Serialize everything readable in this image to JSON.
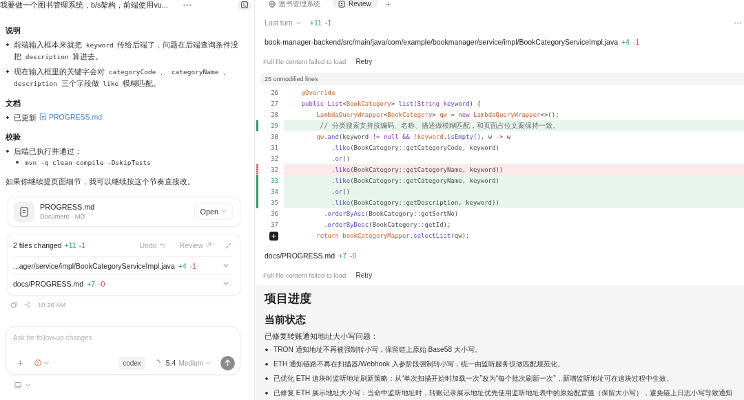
{
  "chat": {
    "thread_title": "我要做一个图书管理系统，b/s架构，前端使用vu...",
    "sections": [
      {
        "heading": "说明",
        "items": [
          {
            "parts": [
              {
                "kind": "text",
                "text": "前端输入框本来就把"
              },
              {
                "kind": "code",
                "text": "keyword"
              },
              {
                "kind": "text",
                "text": "传给后端了，问题在后端查询条件没把"
              },
              {
                "kind": "code",
                "text": "description"
              },
              {
                "kind": "text",
                "text": "算进去。"
              }
            ]
          },
          {
            "parts": [
              {
                "kind": "text",
                "text": "现在输入框里的关键字会对"
              },
              {
                "kind": "code",
                "text": "categoryCode"
              },
              {
                "kind": "text",
                "text": "、"
              },
              {
                "kind": "code",
                "text": "categoryName"
              },
              {
                "kind": "text",
                "text": "、"
              },
              {
                "kind": "code",
                "text": "description"
              },
              {
                "kind": "text",
                "text": "三个字段做"
              },
              {
                "kind": "code",
                "text": "like"
              },
              {
                "kind": "text",
                "text": "模糊匹配。"
              }
            ]
          }
        ]
      },
      {
        "heading": "文档",
        "items": [
          {
            "parts": [
              {
                "kind": "text",
                "text": "已更新"
              }
            ],
            "link": "PROGRESS.md"
          }
        ]
      },
      {
        "heading": "校验",
        "items": [
          {
            "parts": [
              {
                "kind": "text",
                "text": "后端已执行并通过："
              }
            ],
            "children": [
              {
                "parts": [
                  {
                    "kind": "code",
                    "text": "mvn -q clean compile -DskipTests"
                  }
                ]
              }
            ]
          }
        ]
      }
    ],
    "closing": "如果你继续提页面细节，我可以继续按这个节奏直接改。",
    "file_card": {
      "name": "PROGRESS.md",
      "meta": "Document · MD",
      "action": "Open"
    },
    "changes": {
      "summary": "2 files changed",
      "added": "+11",
      "removed": "-1",
      "undo": "Undo",
      "review": "Review",
      "files": [
        {
          "path": "...ager/service/impl/BookCategoryServiceImpl.java",
          "added": "+4",
          "removed": "-1"
        },
        {
          "path": "docs/PROGRESS.md",
          "added": "+7",
          "removed": "-0"
        }
      ]
    },
    "time": "10:26 AM",
    "composer": {
      "placeholder": "Ask for follow-up changes",
      "agent": "codex",
      "model": "5.4",
      "effort": "Medium"
    }
  },
  "tabs": [
    {
      "label": "图书管理系统",
      "kind": "site",
      "selected": false
    },
    {
      "label": "Review",
      "kind": "review",
      "selected": true
    }
  ],
  "review": {
    "scope": "Last turn",
    "added": "+11",
    "removed": "-1",
    "files": [
      {
        "kind": "code",
        "path": "book-manager-backend/src/main/java/com/example/bookmanager/service/impl/BookCategoryServiceImpl.java",
        "added": "+4",
        "removed": "-1",
        "error": "Full file content failed to load",
        "retry": "Retry",
        "collapsed": "25 unmodified lines",
        "lines": [
          {
            "number": "26",
            "kind": "context",
            "hovered": false,
            "tokens": [
              {
                "kind": "annot",
                "text": "    @Override"
              }
            ]
          },
          {
            "number": "27",
            "kind": "context",
            "hovered": false,
            "tokens": [
              {
                "kind": "kw",
                "text": "    public List"
              },
              {
                "kind": "plain",
                "text": "<"
              },
              {
                "kind": "type",
                "text": "BookCategory"
              },
              {
                "kind": "plain",
                "text": "> "
              },
              {
                "kind": "fn",
                "text": "list"
              },
              {
                "kind": "plain",
                "text": "("
              },
              {
                "kind": "kw",
                "text": "String"
              },
              {
                "kind": "fn",
                "text": " keyword"
              },
              {
                "kind": "plain",
                "text": ") {"
              }
            ]
          },
          {
            "number": "28",
            "kind": "context",
            "hovered": false,
            "tokens": [
              {
                "kind": "type",
                "text": "        LambdaQueryWrapper"
              },
              {
                "kind": "plain",
                "text": "<"
              },
              {
                "kind": "type",
                "text": "BookCategory"
              },
              {
                "kind": "plain",
                "text": "> "
              },
              {
                "kind": "type",
                "text": "qw"
              },
              {
                "kind": "plain",
                "text": " = "
              },
              {
                "kind": "kw",
                "text": "new"
              },
              {
                "kind": "type",
                "text": " LambdaQueryWrapper"
              },
              {
                "kind": "plain",
                "text": "<>();"
              }
            ]
          },
          {
            "number": "29",
            "kind": "added",
            "hovered": false,
            "tokens": [
              {
                "kind": "comment",
                "text": "        // 分类搜索支持按编码、名称、描述做模糊匹配，和页面占位文案保持一致。"
              }
            ]
          },
          {
            "number": "30",
            "kind": "context",
            "hovered": false,
            "tokens": [
              {
                "kind": "type",
                "text": "        qw"
              },
              {
                "kind": "fn",
                "text": ".and"
              },
              {
                "kind": "plain",
                "text": "(keyword "
              },
              {
                "kind": "kw",
                "text": "!="
              },
              {
                "kind": "kw",
                "text": " null"
              },
              {
                "kind": "kw",
                "text": " &&"
              },
              {
                "kind": "kw",
                "text": " !"
              },
              {
                "kind": "type",
                "text": "keyword"
              },
              {
                "kind": "fn",
                "text": ".isEmpty"
              },
              {
                "kind": "plain",
                "text": "(), w "
              },
              {
                "kind": "kw",
                "text": "->"
              },
              {
                "kind": "plain",
                "text": " w"
              }
            ]
          },
          {
            "number": "31",
            "kind": "context",
            "hovered": false,
            "tokens": [
              {
                "kind": "fn",
                "text": "            .like"
              },
              {
                "kind": "plain",
                "text": "(BookCategory::getCategoryCode, keyword)"
              }
            ]
          },
          {
            "number": "32",
            "kind": "context",
            "hovered": false,
            "tokens": [
              {
                "kind": "fn",
                "text": "            .or"
              },
              {
                "kind": "plain",
                "text": "()"
              }
            ]
          },
          {
            "number": "32",
            "kind": "removed",
            "hovered": false,
            "tokens": [
              {
                "kind": "fn",
                "text": "            .like"
              },
              {
                "kind": "plain",
                "text": "(BookCategory::getCategoryName, keyword))"
              }
            ]
          },
          {
            "number": "33",
            "kind": "added",
            "hovered": false,
            "tokens": [
              {
                "kind": "fn",
                "text": "            .like"
              },
              {
                "kind": "plain",
                "text": "(BookCategory::getCategoryName, keyword)"
              }
            ]
          },
          {
            "number": "34",
            "kind": "added",
            "hovered": false,
            "tokens": [
              {
                "kind": "fn",
                "text": "            .or"
              },
              {
                "kind": "plain",
                "text": "()"
              }
            ]
          },
          {
            "number": "35",
            "kind": "added",
            "hovered": false,
            "tokens": [
              {
                "kind": "fn",
                "text": "            .like"
              },
              {
                "kind": "plain",
                "text": "(BookCategory::getDescription, keyword))"
              }
            ]
          },
          {
            "number": "36",
            "kind": "context",
            "hovered": false,
            "tokens": [
              {
                "kind": "fn",
                "text": "          .orderByAsc"
              },
              {
                "kind": "plain",
                "text": "(BookCategory::getSortNo)"
              }
            ]
          },
          {
            "number": "37",
            "kind": "context",
            "hovered": false,
            "tokens": [
              {
                "kind": "fn",
                "text": "          .orderByDesc"
              },
              {
                "kind": "plain",
                "text": "(BookCategory::getId);"
              }
            ]
          },
          {
            "kind": "context",
            "hovered": true,
            "tokens": [
              {
                "kind": "type",
                "text": "        return bookCategoryMapper"
              },
              {
                "kind": "fn",
                "text": ".selectList"
              },
              {
                "kind": "plain",
                "text": "(qw);"
              }
            ]
          }
        ]
      },
      {
        "kind": "markdown",
        "path": "docs/PROGRESS.md",
        "added": "+7",
        "removed": "-0",
        "error": "Full file content failed to load",
        "retry": "Retry",
        "preview": {
          "title": "项目进度",
          "subtitle": "当前状态",
          "intro": "已修复转账通知地址大小写问题：",
          "bullets": [
            "TRON 通知地址不再被强制转小写，保留链上原始 Base58 大小写。",
            "ETH 通知链路不再在扫描器/Webhook 入参阶段强制转小写，统一由监听服务仅做匹配规范化。",
            "已优化 ETH 追块时监听地址刷新策略：从“单次扫描开始时加载一次”改为“每个批次刷新一次”，新增监听地址可在追块过程中生效。",
            "已修复 ETH 展示地址大小写：当命中监听地址时，转账记录展示地址优先使用监听地址表中的原始配置值（保留大小写），避免链上日志小写导致通知"
          ]
        }
      }
    ]
  }
}
